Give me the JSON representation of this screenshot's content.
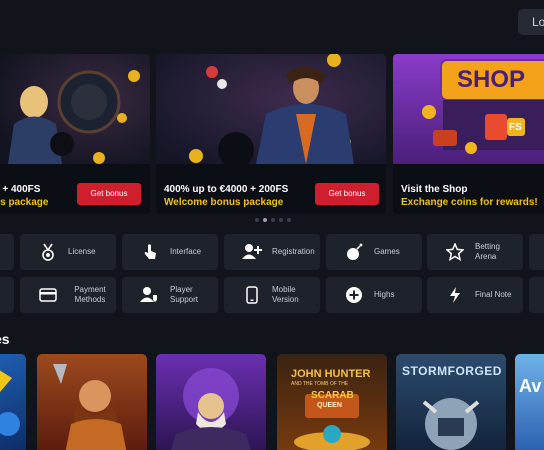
{
  "header": {
    "login_label": "Lo"
  },
  "banners": [
    {
      "title": "0 + 400FS",
      "subtitle": "us package",
      "button": "Get bonus"
    },
    {
      "title": "400% up to €4000 + 200FS",
      "subtitle": "Welcome bonus package",
      "button": "Get bonus"
    },
    {
      "title": "Visit the Shop",
      "subtitle": "Exchange coins for rewards!",
      "art_text": "SHOP",
      "badge": "FS"
    }
  ],
  "carousel": {
    "count": 5,
    "active": 1
  },
  "chips_row1": [
    {
      "label": "",
      "icon": "partial-icon"
    },
    {
      "label": "License",
      "icon": "medal-icon"
    },
    {
      "label": "Interface",
      "icon": "pointer-hand-icon"
    },
    {
      "label": "Registration",
      "icon": "add-user-icon"
    },
    {
      "label": "Games",
      "icon": "bomb-icon"
    },
    {
      "label": "Betting Arena",
      "icon": "star-outline-icon"
    },
    {
      "label": "",
      "icon": "partial-icon"
    }
  ],
  "chips_row2": [
    {
      "label": "",
      "icon": "partial-icon"
    },
    {
      "label": "Payment Methods",
      "icon": "card-icon"
    },
    {
      "label": "Player Support",
      "icon": "support-user-icon"
    },
    {
      "label": "Mobile Version",
      "icon": "phone-icon"
    },
    {
      "label": "Highs",
      "icon": "plus-circle-icon"
    },
    {
      "label": "Final Note",
      "icon": "bolt-icon"
    },
    {
      "label": "",
      "icon": "partial-icon"
    }
  ],
  "section": {
    "title": "es"
  },
  "games": [
    {
      "title": ""
    },
    {
      "title": ""
    },
    {
      "title": ""
    },
    {
      "title": "JOHN HUNTER",
      "subtitle": "AND THE TOMB OF THE",
      "tag": "SCARAB",
      "tag2": "QUEEN"
    },
    {
      "title": "STORMFORGED"
    },
    {
      "title": "Av"
    }
  ]
}
